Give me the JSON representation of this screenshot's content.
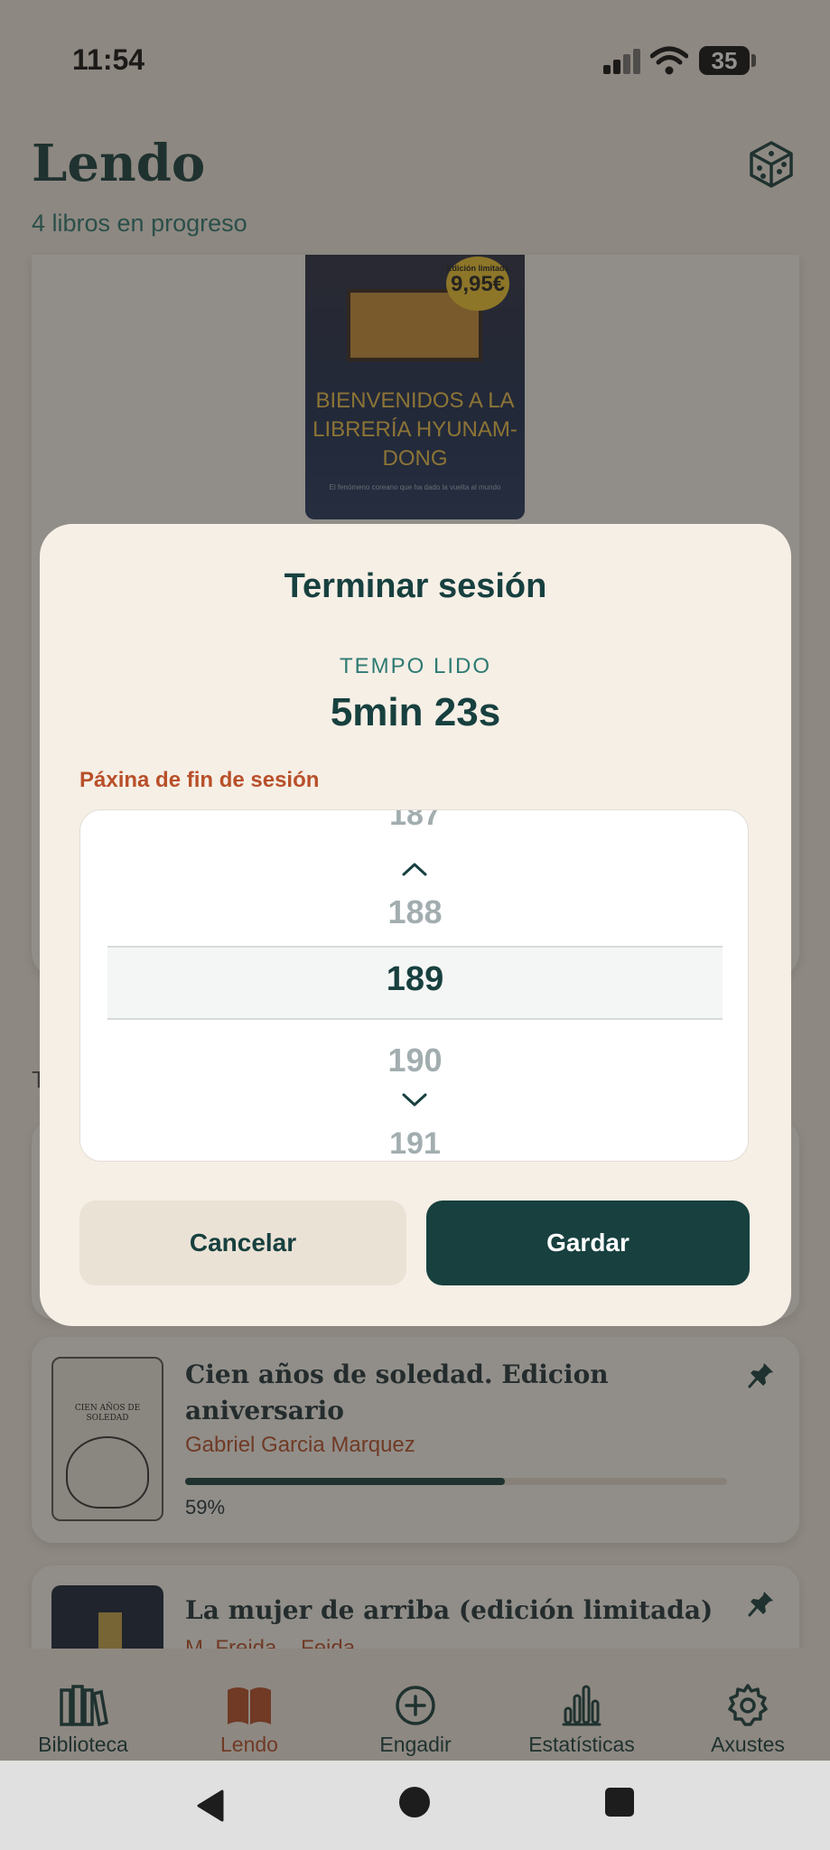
{
  "status_bar": {
    "time": "11:54",
    "battery": "35"
  },
  "header": {
    "title": "Lendo",
    "subtitle": "4 libros en progreso",
    "random_icon": "dice-icon"
  },
  "current_book": {
    "cover_title": "BIENVENIDOS A LA LIBRERÍA HYUNAM-DONG",
    "cover_badge_top": "Edición limitada",
    "cover_badge_price": "9,95€",
    "cover_tagline": "El fenómeno coreano que ha dado la vuelta al mundo"
  },
  "section_heading": "T",
  "books": [
    {
      "title": "Cien años de soledad. Edicion aniversario",
      "author": "Gabriel Garcia Marquez",
      "progress_label": "59%",
      "progress": 0.59,
      "cover_text": "CIEN AÑOS DE SOLEDAD"
    },
    {
      "title": "La mujer de arriba (edición limitada)",
      "author": "M. Freida... Feida...",
      "progress": 0
    }
  ],
  "dialog": {
    "title": "Terminar sesión",
    "elapsed_label": "TEMPO LIDO",
    "elapsed_value": "5min 23s",
    "page_label": "Páxina de fin de sesión",
    "picker": {
      "prev_partial": "187",
      "prev": "188",
      "selected": "189",
      "next": "190",
      "next_partial": "191"
    },
    "cancel_label": "Cancelar",
    "save_label": "Gardar"
  },
  "bottom_nav": [
    {
      "label": "Biblioteca",
      "icon": "library-icon",
      "active": false
    },
    {
      "label": "Lendo",
      "icon": "open-book-icon",
      "active": true
    },
    {
      "label": "Engadir",
      "icon": "add-circle-icon",
      "active": false
    },
    {
      "label": "Estatísticas",
      "icon": "bar-chart-icon",
      "active": false
    },
    {
      "label": "Axustes",
      "icon": "settings-gear-icon",
      "active": false
    }
  ],
  "colors": {
    "primary": "#17403f",
    "accent": "#b8502a",
    "teal": "#2d7a72",
    "background": "#f4ede4",
    "dialog_bg": "#f6efe6"
  }
}
